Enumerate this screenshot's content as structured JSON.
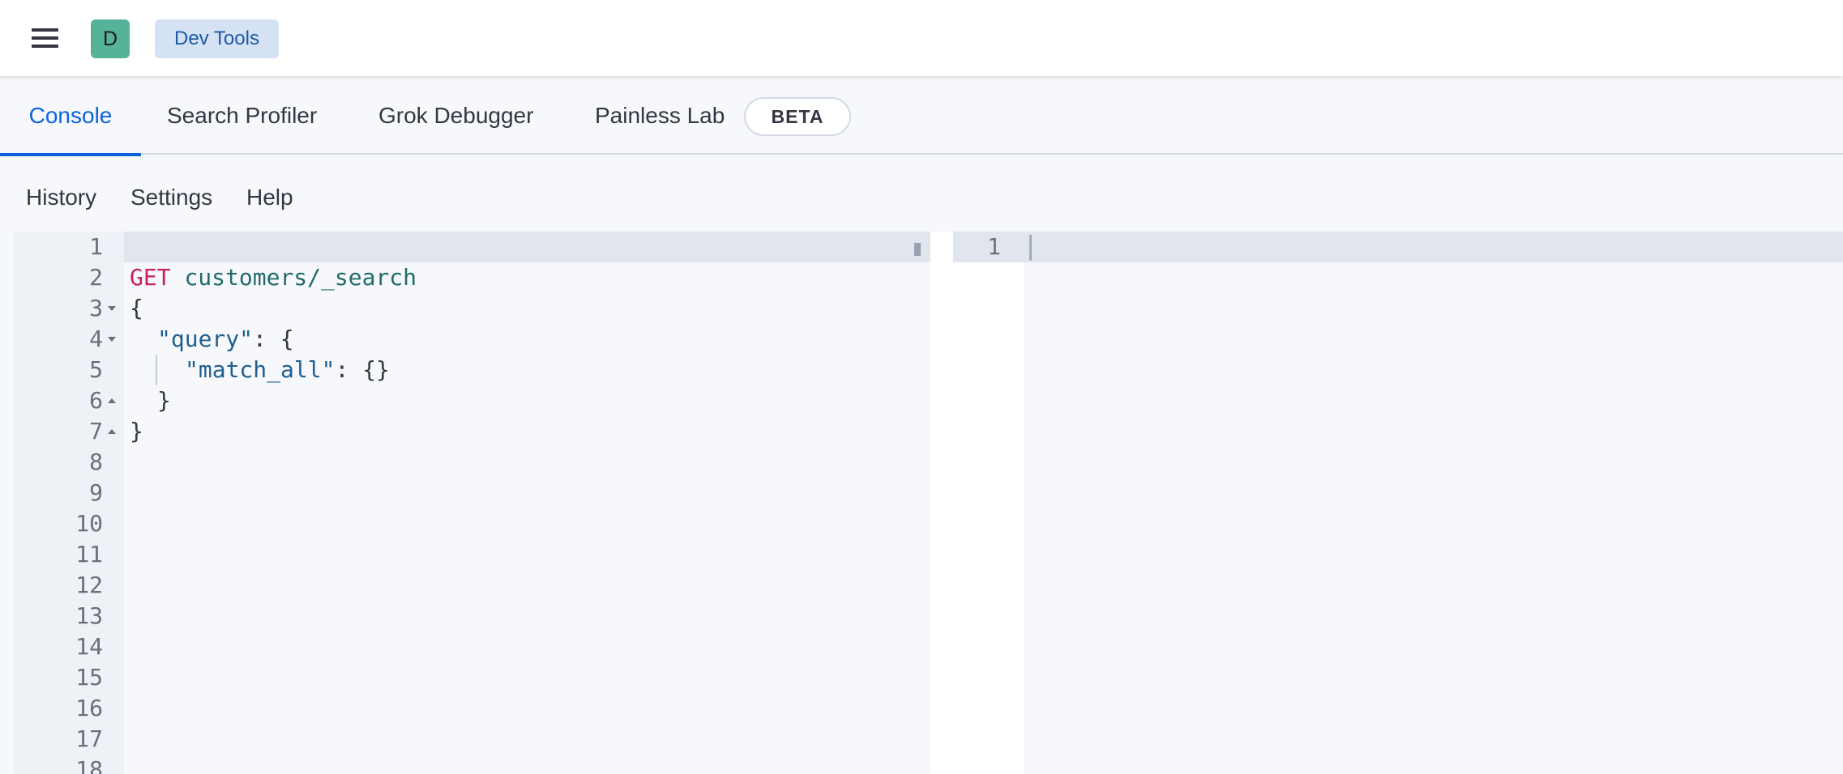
{
  "header": {
    "avatar_letter": "D",
    "breadcrumb": "Dev Tools"
  },
  "tabs": [
    {
      "label": "Console",
      "selected": true
    },
    {
      "label": "Search Profiler",
      "selected": false
    },
    {
      "label": "Grok Debugger",
      "selected": false
    },
    {
      "label": "Painless Lab",
      "selected": false
    }
  ],
  "beta_badge": "BETA",
  "topnav": {
    "history": "History",
    "settings": "Settings",
    "help": "Help"
  },
  "request_editor": {
    "line_numbers": [
      "1",
      "2",
      "3",
      "4",
      "5",
      "6",
      "7",
      "8",
      "9",
      "10",
      "11",
      "12",
      "13",
      "14",
      "15",
      "16",
      "17",
      "18"
    ],
    "method": "GET",
    "path": "customers/_search",
    "line3": "{",
    "line4_key": "\"query\"",
    "line4_rest": ": {",
    "line5_key": "\"match_all\"",
    "line5_rest": ": {}",
    "line6": "}",
    "line7": "}"
  },
  "response_editor": {
    "line_numbers": [
      "1"
    ]
  },
  "colors": {
    "accent": "#0b64dd",
    "method": "#c61e60",
    "path": "#216b6b",
    "string_key": "#1f5f8f",
    "avatar": "#54b399"
  }
}
